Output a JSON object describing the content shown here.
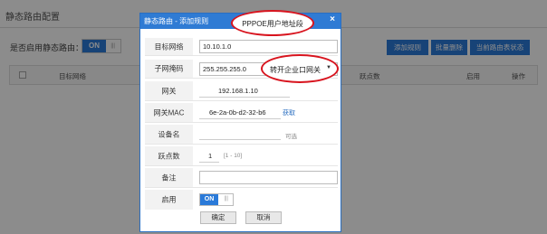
{
  "background": {
    "page_title": "静态路由配置",
    "enable_label": "是否启用静态路由：",
    "toggle_on": "ON",
    "toggle_grip": "|||",
    "buttons": {
      "add": "添加规则",
      "batch_delete": "批量删除",
      "current_status": "当前路由表状态"
    },
    "table_headers": {
      "target": "目标网络",
      "hops": "跃点数",
      "enable": "启用",
      "action": "操作"
    }
  },
  "modal": {
    "title": "静态路由 - 添加规则",
    "close": "×",
    "fields": {
      "target_network": {
        "label": "目标网络",
        "value": "10.10.1.0"
      },
      "subnet_mask": {
        "label": "子网掩码",
        "value": "255.255.255.0"
      },
      "gateway": {
        "label": "网关",
        "value": "192.168.1.10"
      },
      "gateway_mac": {
        "label": "网关MAC",
        "value": "6e-2a-0b-d2-32-b6",
        "link": "获取"
      },
      "device_name": {
        "label": "设备名",
        "hint": "可选"
      },
      "hops": {
        "label": "跃点数",
        "value": "1",
        "hint": "[1 - 10]"
      },
      "note": {
        "label": "备注",
        "value": ""
      },
      "enable": {
        "label": "启用",
        "on": "ON",
        "grip": "|||"
      }
    },
    "confirm": "确定",
    "cancel": "取消"
  },
  "annotations": {
    "top": "PPPOE用户地址段",
    "middle": "转开企业口网关",
    "middle_arrow": "▼"
  }
}
